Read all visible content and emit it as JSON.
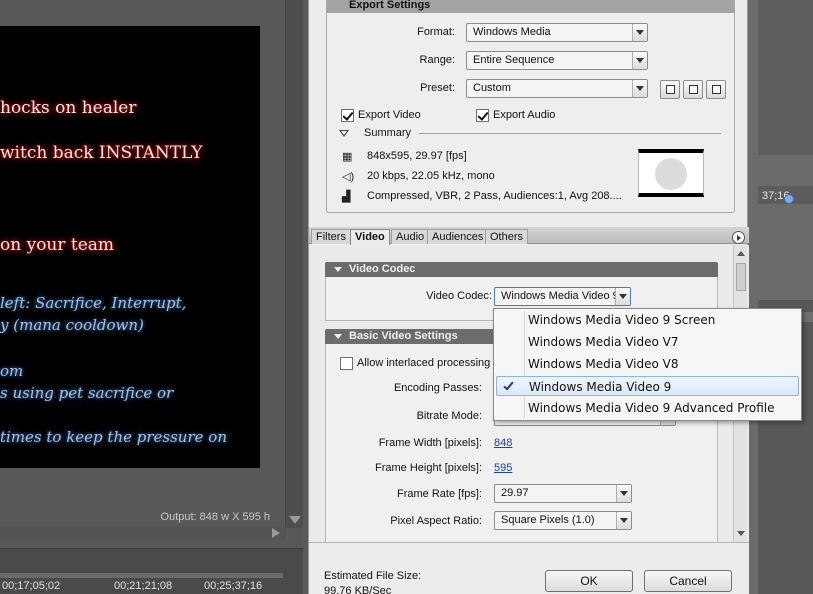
{
  "preview": {
    "lines": [
      {
        "text": "hocks on healer",
        "style": "red"
      },
      {
        "text": "witch back INSTANTLY",
        "style": "red"
      },
      {
        "text": "on your team",
        "style": "red"
      },
      {
        "text": "left: Sacrifice, Interrupt,",
        "style": "blue"
      },
      {
        "text": "y (mana cooldown)",
        "style": "blue"
      },
      {
        "text": "om",
        "style": "blue"
      },
      {
        "text": "s using pet sacrifice or",
        "style": "blue"
      },
      {
        "text": "times to keep the pressure on",
        "style": "blue"
      }
    ],
    "output_label": "Output: 848 w X 595 h"
  },
  "timeline": {
    "timecodes": [
      "00;17;05;02",
      "00;21;21;08",
      "00;25;37;16"
    ],
    "right_timecode": "37;16"
  },
  "export_settings": {
    "title": "Export Settings",
    "format_label": "Format:",
    "format_value": "Windows Media",
    "range_label": "Range:",
    "range_value": "Entire Sequence",
    "preset_label": "Preset:",
    "preset_value": "Custom",
    "export_video_label": "Export Video",
    "export_video_checked": true,
    "export_audio_label": "Export Audio",
    "export_audio_checked": true,
    "summary_label": "Summary",
    "summary_video": "848x595, 29.97 [fps]",
    "summary_audio": "20 kbps, 22.05 kHz, mono",
    "summary_bitrate": "Compressed, VBR, 2 Pass, Audiences:1, Avg 208...."
  },
  "tabs": [
    {
      "label": "Filters",
      "active": false
    },
    {
      "label": "Video",
      "active": true
    },
    {
      "label": "Audio",
      "active": false
    },
    {
      "label": "Audiences",
      "active": false
    },
    {
      "label": "Others",
      "active": false
    }
  ],
  "video_codec": {
    "section_title": "Video Codec",
    "codec_label": "Video Codec:",
    "codec_value": "Windows Media Video 9"
  },
  "basic_video": {
    "section_title": "Basic Video Settings",
    "interlaced_label": "Allow interlaced processing",
    "encoding_passes_label": "Encoding Passes:",
    "bitrate_mode_label": "Bitrate Mode:",
    "frame_width_label": "Frame Width [pixels]:",
    "frame_width_value": "848",
    "frame_height_label": "Frame Height [pixels]:",
    "frame_height_value": "595",
    "frame_rate_label": "Frame Rate [fps]:",
    "frame_rate_value": "29.97",
    "par_label": "Pixel Aspect Ratio:",
    "par_value": "Square Pixels (1.0)"
  },
  "codec_dropdown": {
    "options": [
      {
        "label": "Windows Media Video 9 Screen",
        "selected": false
      },
      {
        "label": "Windows Media Video V7",
        "selected": false
      },
      {
        "label": "Windows Media Video V8",
        "selected": false
      },
      {
        "label": "Windows Media Video 9",
        "selected": true
      },
      {
        "label": "Windows Media Video 9 Advanced Profile",
        "selected": false
      }
    ]
  },
  "footer": {
    "estimated_label": "Estimated File Size:",
    "estimated_value": "99.76 KB/Sec",
    "ok_label": "OK",
    "cancel_label": "Cancel"
  },
  "colors": {
    "dialog_bg": "#ececec",
    "section_header": "#6c6c6c",
    "selection_border": "#8db2e3",
    "link_blue": "#1e3fb0"
  }
}
